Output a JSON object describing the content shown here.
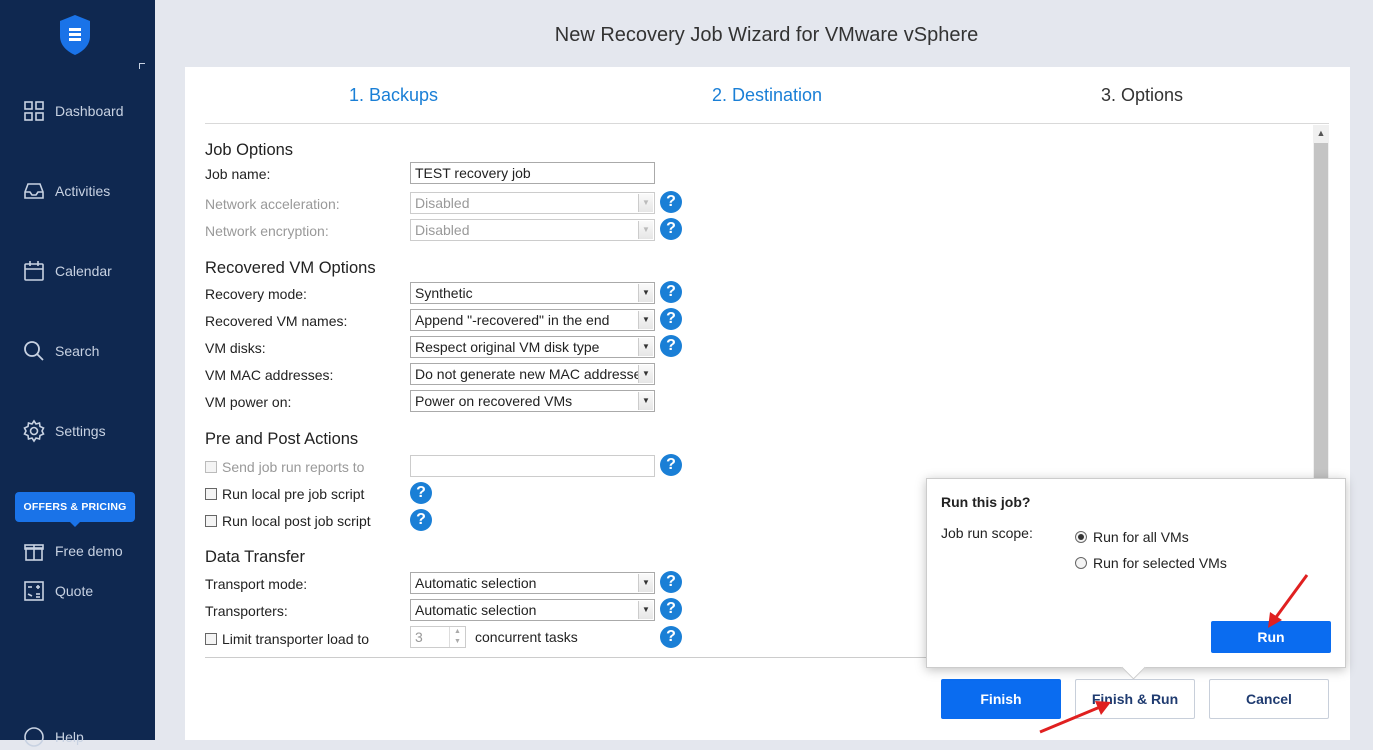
{
  "sidebar": {
    "items": [
      {
        "label": "Dashboard",
        "icon": "grid-icon"
      },
      {
        "label": "Activities",
        "icon": "inbox-icon"
      },
      {
        "label": "Calendar",
        "icon": "calendar-icon"
      },
      {
        "label": "Search",
        "icon": "search-icon"
      },
      {
        "label": "Settings",
        "icon": "gear-icon"
      }
    ],
    "offers_label": "OFFERS & PRICING",
    "extra_items": [
      {
        "label": "Free demo",
        "icon": "gift-icon"
      },
      {
        "label": "Quote",
        "icon": "calculator-icon"
      }
    ],
    "help_label": "Help"
  },
  "wizard": {
    "title": "New Recovery Job Wizard for VMware vSphere",
    "steps": [
      "1. Backups",
      "2. Destination",
      "3. Options"
    ],
    "active_step": "3. Options"
  },
  "job_options": {
    "heading": "Job Options",
    "job_name_label": "Job name:",
    "job_name_value": "TEST recovery job",
    "net_accel_label": "Network acceleration:",
    "net_accel_value": "Disabled",
    "net_enc_label": "Network encryption:",
    "net_enc_value": "Disabled"
  },
  "vm_options": {
    "heading": "Recovered VM Options",
    "recovery_mode_label": "Recovery mode:",
    "recovery_mode_value": "Synthetic",
    "vm_names_label": "Recovered VM names:",
    "vm_names_value": "Append \"-recovered\" in the end",
    "vm_disks_label": "VM disks:",
    "vm_disks_value": "Respect original VM disk type",
    "mac_label": "VM MAC addresses:",
    "mac_value": "Do not generate new MAC addresses",
    "power_label": "VM power on:",
    "power_value": "Power on recovered VMs"
  },
  "pre_post": {
    "heading": "Pre and Post Actions",
    "send_reports_label": "Send job run reports to",
    "pre_script_label": "Run local pre job script",
    "post_script_label": "Run local post job script"
  },
  "data_transfer": {
    "heading": "Data Transfer",
    "transport_mode_label": "Transport mode:",
    "transport_mode_value": "Automatic selection",
    "transporters_label": "Transporters:",
    "transporters_value": "Automatic selection",
    "limit_label": "Limit transporter load to",
    "limit_value": "3",
    "limit_suffix": "concurrent tasks"
  },
  "footer": {
    "finish": "Finish",
    "finish_run": "Finish & Run",
    "cancel": "Cancel"
  },
  "popup": {
    "title": "Run this job?",
    "scope_label": "Job run scope:",
    "options": [
      "Run for all VMs",
      "Run for selected VMs"
    ],
    "selected": "Run for all VMs",
    "run_button": "Run"
  },
  "colors": {
    "sidebar_bg": "#0f2850",
    "accent": "#0a6cf0",
    "link": "#1a7fd6",
    "annotation": "#e02020"
  }
}
